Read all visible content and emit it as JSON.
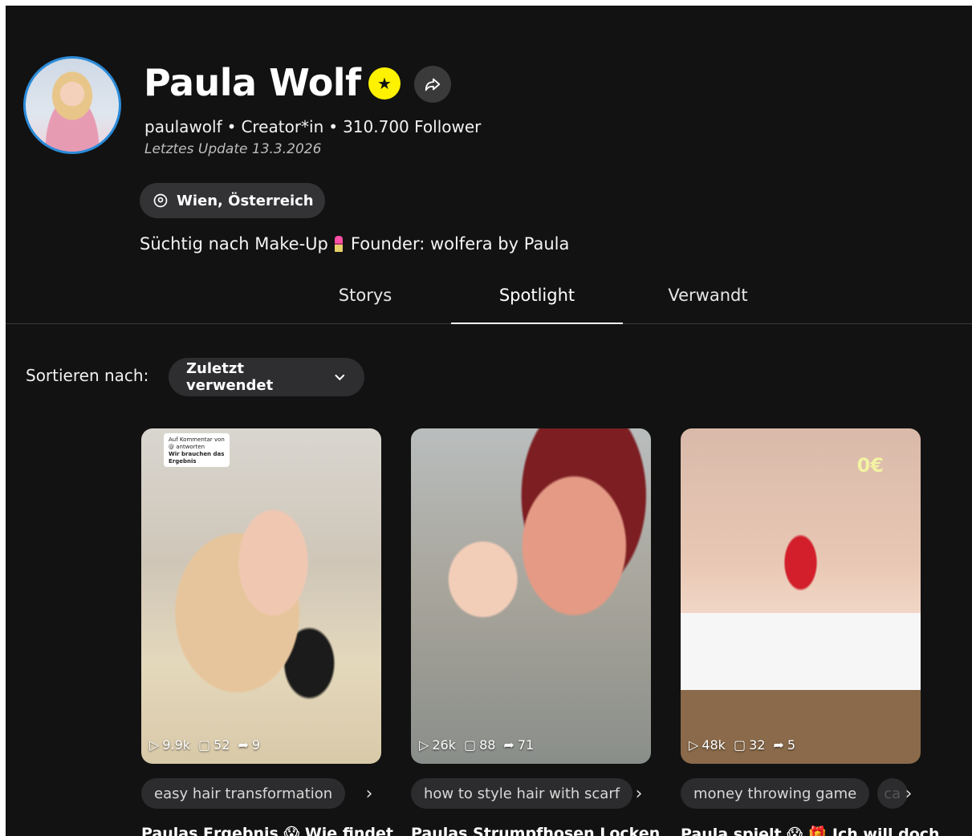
{
  "profile": {
    "name": "Paula Wolf",
    "username": "paulawolf",
    "role": "Creator*in",
    "followers": "310.700 Follower",
    "updated": "Letztes Update 13.3.2026",
    "location": "Wien, Österreich",
    "bio_part1": "Süchtig nach Make-Up",
    "bio_part2": "Founder: wolfera by Paula"
  },
  "tabs": [
    {
      "label": "Storys"
    },
    {
      "label": "Spotlight",
      "active": true
    },
    {
      "label": "Verwandt"
    }
  ],
  "sort": {
    "label": "Sortieren nach:",
    "selected": "Zuletzt verwendet"
  },
  "cards": [
    {
      "views": "9.9k",
      "comments": "52",
      "shares": "9",
      "tag": "easy hair transformation",
      "title": "Paulas Ergebnis 😱 Wie findet",
      "sticker_line1": "Auf Kommentar von @ antworten",
      "sticker_line2": "Wir brauchen das Ergebnis"
    },
    {
      "views": "26k",
      "comments": "88",
      "shares": "71",
      "tag": "how to style hair with scarf",
      "title": "Paulas Strumpfhosen Locken"
    },
    {
      "views": "48k",
      "comments": "32",
      "shares": "5",
      "tag": "money throwing game",
      "tag_faded": "ca",
      "title": "Paula spielt 😱 🎁 Ich will doch",
      "overlay": "0€"
    }
  ],
  "colors": {
    "background": "#121212",
    "badge": "#fff200",
    "avatar_ring": "#2b8bd8"
  }
}
